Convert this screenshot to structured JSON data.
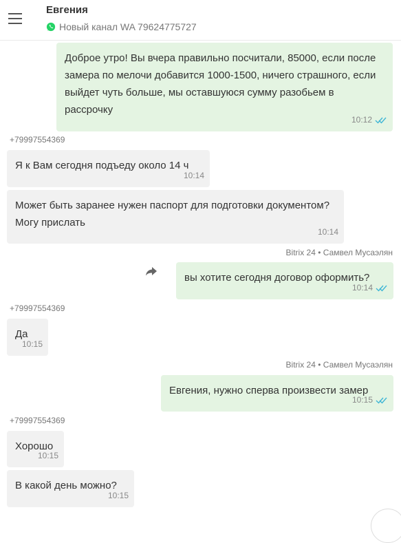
{
  "header": {
    "contact_name": "Евгения",
    "channel": "Новый канал WA 79624775727"
  },
  "messages": [
    {
      "text": "Доброе утро! Вы вчера правильно посчитали, 85000, если после замера по мелочи добавится 1000-1500, ничего страшного, если выйдет чуть больше, мы оставшуюся сумму разобьем в рассрочку",
      "time": "10:12"
    },
    {
      "sender": "+79997554369",
      "text": "Я к Вам сегодня подъеду около 14 ч",
      "time": "10:14"
    },
    {
      "text": "Может быть заранее нужен паспорт для подготовки документом? Могу прислать",
      "time": "10:14"
    },
    {
      "sender": "Bitrix 24 • Самвел Мусаэлян",
      "text": "вы хотите сегодня договор оформить?",
      "time": "10:14"
    },
    {
      "sender": "+79997554369",
      "text": "Да",
      "time": "10:15"
    },
    {
      "sender": "Bitrix 24 • Самвел Мусаэлян",
      "text": "Евгения, нужно сперва произвести замер",
      "time": "10:15"
    },
    {
      "sender": "+79997554369",
      "text": "Хорошо",
      "time": "10:15"
    },
    {
      "text": "В какой день можно?",
      "time": "10:15"
    }
  ],
  "colors": {
    "incoming_bubble": "#f1f1f1",
    "outgoing_bubble": "#e4f4e2",
    "whatsapp_green": "#25d366",
    "read_check": "#3fb6d6"
  },
  "icons": [
    "menu-icon",
    "whatsapp-icon",
    "double-check-icon",
    "share-icon"
  ]
}
